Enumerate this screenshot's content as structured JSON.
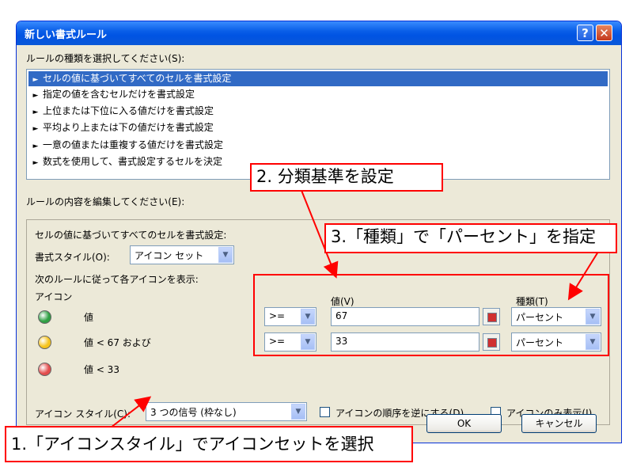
{
  "dialog": {
    "title": "新しい書式ルール",
    "help_glyph": "?",
    "close_glyph": "✕"
  },
  "rule_type": {
    "label": "ルールの種類を選択してください(S):",
    "items": [
      "セルの値に基づいてすべてのセルを書式設定",
      "指定の値を含むセルだけを書式設定",
      "上位または下位に入る値だけを書式設定",
      "平均より上または下の値だけを書式設定",
      "一意の値または重複する値だけを書式設定",
      "数式を使用して、書式設定するセルを決定"
    ],
    "selected_index": 0
  },
  "rule_edit": {
    "label": "ルールの内容を編集してください(E):",
    "description": "セルの値に基づいてすべてのセルを書式設定:",
    "format_style_label": "書式スタイル(O):",
    "format_style_value": "アイコン セット",
    "display_rule_label": "次のルールに従って各アイコンを表示:",
    "icon_header": "アイコン",
    "value_header": "値(V)",
    "type_header": "種類(T)",
    "icon_rows": [
      {
        "color": "#2ea043",
        "text": "値"
      },
      {
        "color": "#f6c31b",
        "text": "値 < 67 および"
      },
      {
        "color": "#e34d4d",
        "text": "値 < 33"
      }
    ],
    "condition_rows": [
      {
        "operator": ">=",
        "value": "67",
        "type": "パーセント"
      },
      {
        "operator": ">=",
        "value": "33",
        "type": "パーセント"
      }
    ],
    "icon_style_label": "アイコン スタイル(C):",
    "icon_style_value": "3 つの信号 (枠なし)",
    "reverse_order_label": "アイコンの順序を逆にする(D)",
    "reverse_order_checked": false,
    "icon_only_label": "アイコンのみ表示(I)",
    "icon_only_checked": false
  },
  "buttons": {
    "ok": "OK",
    "cancel": "キャンセル"
  },
  "annotations": {
    "step1": "1.「アイコンスタイル」でアイコンセットを選択",
    "step2": "2. 分類基準を設定",
    "step3": "3.「種類」で「パーセント」を指定",
    "color": "#ff0000"
  }
}
